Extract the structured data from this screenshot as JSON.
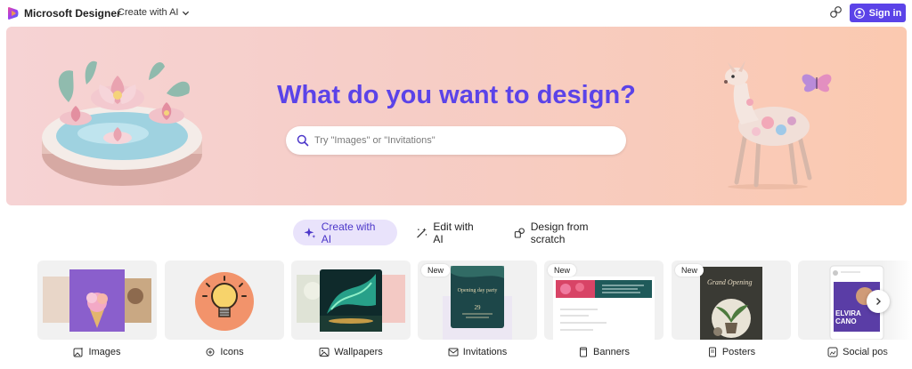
{
  "topbar": {
    "brand": "Microsoft Designer",
    "create_menu_label": "Create with AI",
    "signin_label": "Sign in"
  },
  "hero": {
    "title": "What do you want to design?",
    "search_placeholder": "Try \"Images\" or \"Invitations\""
  },
  "tabs": [
    {
      "label": "Create with AI",
      "icon": "sparkle-icon",
      "active": true
    },
    {
      "label": "Edit with AI",
      "icon": "magic-wand-icon",
      "active": false
    },
    {
      "label": "Design from scratch",
      "icon": "shapes-icon",
      "active": false
    }
  ],
  "cards": [
    {
      "label": "Images",
      "icon": "image-sparkle-icon",
      "badge": ""
    },
    {
      "label": "Icons",
      "icon": "icon-sparkle-icon",
      "badge": ""
    },
    {
      "label": "Wallpapers",
      "icon": "wallpaper-icon",
      "badge": ""
    },
    {
      "label": "Invitations",
      "icon": "invitation-icon",
      "badge": "New"
    },
    {
      "label": "Banners",
      "icon": "banner-icon",
      "badge": "New"
    },
    {
      "label": "Posters",
      "icon": "poster-icon",
      "badge": "New"
    },
    {
      "label": "Social pos",
      "icon": "social-post-icon",
      "badge": ""
    }
  ],
  "card_content": {
    "invitation_title": "Opening day party",
    "invitation_date": "29",
    "poster_title": "Grand Opening",
    "social_name_line1": "ELVIRA",
    "social_name_line2": "CANO"
  },
  "colors": {
    "accent": "#5b43e8",
    "tab_active_bg": "#e9e3fb",
    "hero_gradient_start": "#f6d3d4",
    "hero_gradient_end": "#fbc9b0"
  }
}
